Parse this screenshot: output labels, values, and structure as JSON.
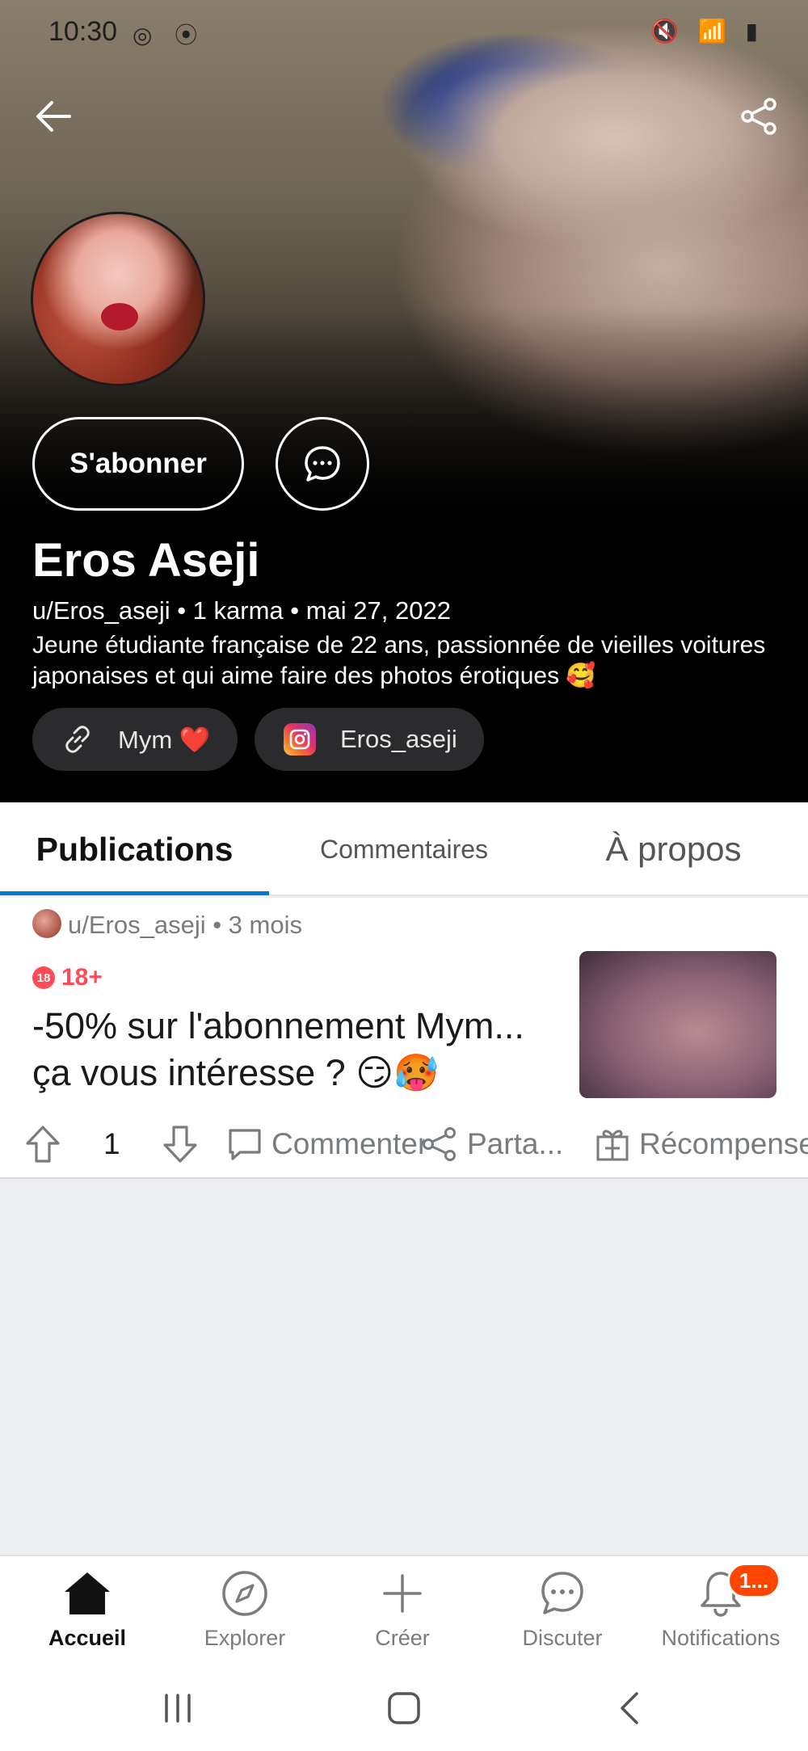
{
  "status_bar": {
    "time": "10:30",
    "left_icons": "◎ ⦿",
    "right_icons": "🔇 📶 ▮"
  },
  "profile": {
    "display_name": "Eros Aseji",
    "meta": "u/Eros_aseji • 1 karma • mai 27, 2022",
    "bio": "Jeune étudiante française de 22 ans, passionnée de vieilles voitures japonaises et qui aime faire des photos érotiques 🥰",
    "subscribe_label": "S'abonner",
    "links": [
      {
        "label": "Mym ❤️",
        "icon": "link-icon"
      },
      {
        "label": "Eros_aseji",
        "icon": "instagram-icon"
      }
    ]
  },
  "tabs": [
    {
      "label": "Publications",
      "active": true
    },
    {
      "label": "Commentaires",
      "active": false
    },
    {
      "label": "À propos",
      "active": false
    }
  ],
  "post": {
    "meta": "u/Eros_aseji • 3 mois",
    "nsfw_badge_icon": "18",
    "nsfw_label": "18+",
    "title": "-50% sur l'abonnement Mym... ça vous intéresse ? 😏🥵",
    "vote_count": "1",
    "comment_label": "Commenter",
    "share_label": "Parta...",
    "award_label": "Récompenser"
  },
  "bottom_nav": [
    {
      "label": "Accueil",
      "icon": "home-icon",
      "active": true
    },
    {
      "label": "Explorer",
      "icon": "compass-icon",
      "active": false
    },
    {
      "label": "Créer",
      "icon": "plus-icon",
      "active": false
    },
    {
      "label": "Discuter",
      "icon": "chat-icon",
      "active": false
    },
    {
      "label": "Notifications",
      "icon": "bell-icon",
      "active": false,
      "badge": "1..."
    }
  ],
  "colors": {
    "accent": "#0079d3",
    "badge": "#ff4500",
    "nsfw": "#ff4a57"
  }
}
